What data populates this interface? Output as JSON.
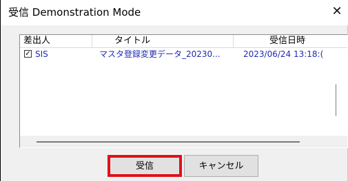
{
  "window": {
    "title": "受信 Demonstration Mode",
    "close_icon": "close-icon"
  },
  "list": {
    "columns": [
      "差出人",
      "タイトル",
      "受信日時"
    ],
    "rows": [
      {
        "checked": true,
        "sender": "SIS",
        "title": "マスタ登録変更データ_20230...",
        "received": "2023/06/24 13:18:("
      }
    ]
  },
  "buttons": {
    "receive": "受信",
    "cancel": "キャンセル"
  },
  "colors": {
    "link_text": "#1d2bb0",
    "highlight": "#e0101a"
  }
}
